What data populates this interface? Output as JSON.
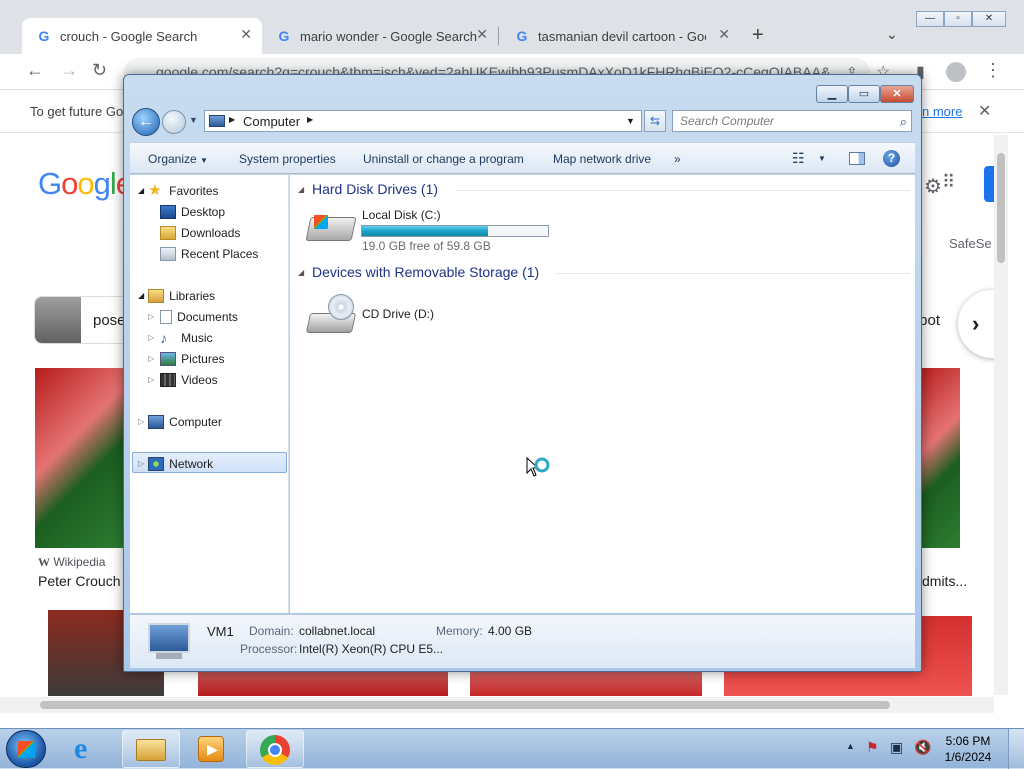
{
  "browser": {
    "tabs": [
      {
        "title": "crouch - Google Search",
        "active": true
      },
      {
        "title": "mario wonder - Google Search",
        "active": false
      },
      {
        "title": "tasmanian devil cartoon - Google",
        "active": false
      }
    ],
    "url": "google.com/search?q=crouch&tbm=isch&ved=2ahUKEwibb93PusmDAxXoD1kFHRhgBiEQ2-cCegQIABAA&",
    "infobar_text": "To get future Go",
    "infobar_link": "n more",
    "google_logo": "Google",
    "safesearch": "SafeSe",
    "chips": [
      "pose",
      "pot"
    ],
    "image_source": "Wikipedia",
    "image_caption": "Peter Crouch",
    "image_caption_right": "dmits..."
  },
  "explorer": {
    "address": {
      "crumb": "Computer"
    },
    "search_placeholder": "Search Computer",
    "commands": {
      "organize": "Organize",
      "system_properties": "System properties",
      "uninstall": "Uninstall or change a program",
      "map_drive": "Map network drive",
      "more": "»"
    },
    "nav": {
      "favorites": "Favorites",
      "desktop": "Desktop",
      "downloads": "Downloads",
      "recent": "Recent Places",
      "libraries": "Libraries",
      "documents": "Documents",
      "music": "Music",
      "pictures": "Pictures",
      "videos": "Videos",
      "computer": "Computer",
      "network": "Network"
    },
    "groups": {
      "hdd": "Hard Disk Drives (1)",
      "removable": "Devices with Removable Storage (1)"
    },
    "drives": {
      "c_name": "Local Disk (C:)",
      "c_free": "19.0 GB free of 59.8 GB",
      "c_used_fraction": 0.68,
      "d_name": "CD Drive (D:)"
    },
    "details": {
      "name": "VM1",
      "domain_label": "Domain:",
      "domain": "collabnet.local",
      "memory_label": "Memory:",
      "memory": "4.00 GB",
      "processor_label": "Processor:",
      "processor": "Intel(R) Xeon(R) CPU E5..."
    }
  },
  "taskbar": {
    "time": "5:06 PM",
    "date": "1/6/2024"
  },
  "colors": {
    "explorer_group_header": "#1e3287",
    "capacity_bar": "#1aa3c7",
    "close_button": "#c74a30"
  }
}
